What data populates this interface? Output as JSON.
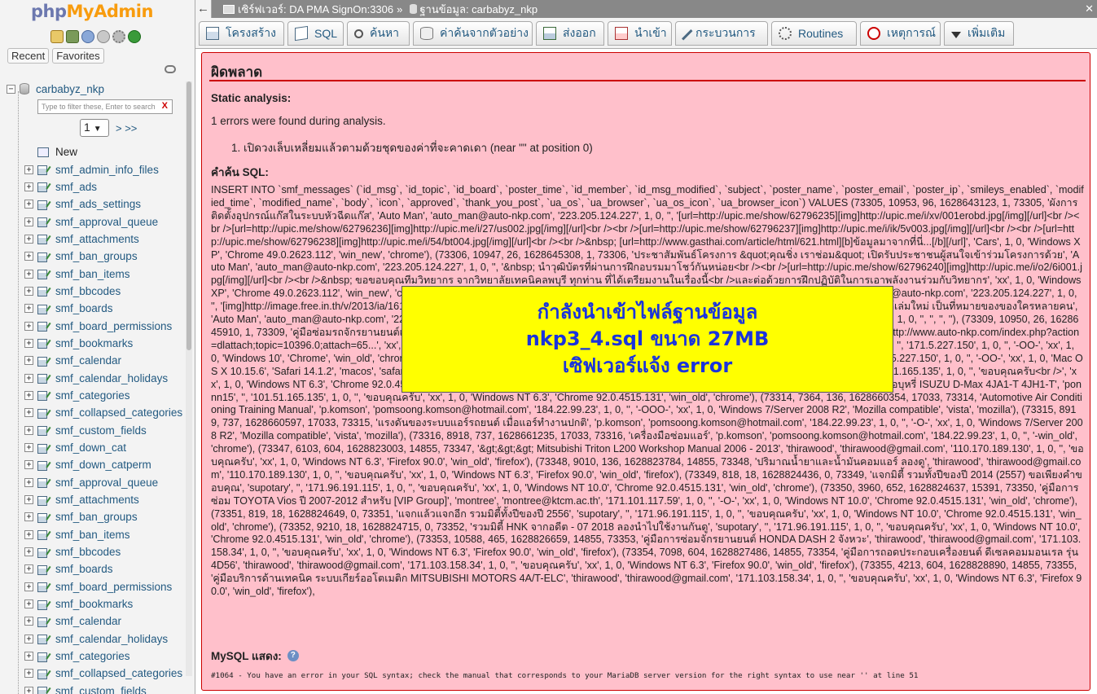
{
  "sidebar": {
    "logo_php": "php",
    "logo_pma": "MyAdmin",
    "quick_icons": [
      "home-icon",
      "logout-icon",
      "help-icon",
      "docs-icon",
      "settings-icon",
      "reload-icon"
    ],
    "tab_recent": "Recent",
    "tab_favorites": "Favorites",
    "database": "carbabyz_nkp",
    "filter_placeholder": "Type to filter these, Enter to search",
    "filter_clear": "X",
    "page_select": "1",
    "page_next": "> >>",
    "new_label": "New",
    "tables": [
      "smf_admin_info_files",
      "smf_ads",
      "smf_ads_settings",
      "smf_approval_queue",
      "smf_attachments",
      "smf_ban_groups",
      "smf_ban_items",
      "smf_bbcodes",
      "smf_boards",
      "smf_board_permissions",
      "smf_bookmarks",
      "smf_calendar",
      "smf_calendar_holidays",
      "smf_categories",
      "smf_collapsed_categories",
      "smf_custom_fields",
      "smf_down_cat",
      "smf_down_catperm",
      "smf_approval_queue",
      "smf_attachments",
      "smf_ban_groups",
      "smf_ban_items",
      "smf_bbcodes",
      "smf_boards",
      "smf_board_permissions",
      "smf_bookmarks",
      "smf_calendar",
      "smf_calendar_holidays",
      "smf_categories",
      "smf_collapsed_categories",
      "smf_custom_fields"
    ]
  },
  "breadcrumb": {
    "server": "เซิร์ฟเวอร์: DA PMA SignOn:3306",
    "separator": "»",
    "database": "ฐานข้อมูล: carbabyz_nkp"
  },
  "tabs": [
    {
      "label": "โครงสร้าง",
      "icon": "structure-icon"
    },
    {
      "label": "SQL",
      "icon": "sql-icon"
    },
    {
      "label": "ค้นหา",
      "icon": "search-icon"
    },
    {
      "label": "ค่าค้นจากตัวอย่าง",
      "icon": "query-icon"
    },
    {
      "label": "ส่งออก",
      "icon": "export-icon"
    },
    {
      "label": "นำเข้า",
      "icon": "import-icon"
    },
    {
      "label": "กระบวนการ",
      "icon": "operations-icon"
    },
    {
      "label": "Routines",
      "icon": "routines-icon"
    },
    {
      "label": "เหตุการณ์",
      "icon": "events-icon"
    },
    {
      "label": "เพิ่มเติม",
      "icon": "more-icon"
    }
  ],
  "error": {
    "title": "ผิดพลาด",
    "static_heading": "Static analysis:",
    "found_text": "1 errors were found during analysis.",
    "error_item": "1. เปิดวงเล็บเหลี่ยมแล้วตามด้วยชุดของค่าที่จะคาดเดา (near \"\" at position 0)",
    "query_heading": "คำค้น SQL:",
    "sql": "INSERT INTO `smf_messages` (`id_msg`, `id_topic`, `id_board`, `poster_time`, `id_member`, `id_msg_modified`, `subject`, `poster_name`, `poster_email`, `poster_ip`, `smileys_enabled`, `modified_time`, `modified_name`, `body`, `icon`, `approved`, `thank_you_post`, `ua_os`, `ua_browser`, `ua_os_icon`, `ua_browser_icon`) VALUES (73305, 10953, 96, 1628643123, 1, 73305, 'ผังการติดตั้งอุปกรณ์แก๊สในระบบหัวฉีดแก๊ส', 'Auto Man', 'auto_man@auto-nkp.com', '223.205.124.227', 1, 0, '', '[url=http://upic.me/show/62796235][img]http://upic.me/i/xv/001erobd.jpg[/img][/url]<br /><br />[url=http://upic.me/show/62796236][img]http://upic.me/i/27/us002.jpg[/img][/url]<br /><br />[url=http://upic.me/show/62796237][img]http://upic.me/i/ik/5v003.jpg[/img][/url]<br /><br />[url=http://upic.me/show/62796238][img]http://upic.me/i/54/bt004.jpg[/img][/url]<br /><br />&nbsp; [url=http://www.gasthai.com/article/html/621.html][b]ข้อมูลมาจากที่นี่...[/b][/url]', 'Cars', 1, 0, 'Windows XP', 'Chrome 49.0.2623.112', 'win_new', 'chrome'), (73306, 10947, 26, 1628645308, 1, 73306, 'ประชาสัมพันธ์โครงการ &quot;คุณชิ่ง เราช่อม&quot; เปิดรับประชาชนผู้สนใจเข้าร่วมโครงการด้วย', 'Auto Man', 'auto_man@auto-nkp.com', '223.205.124.227', 1, 0, '', '&nbsp; นำวุฒิบัตรที่ผ่านการฝึกอบรมมาโชว์กันหน่อย<br /><br />[url=http://upic.me/show/62796240][img]http://upic.me/i/o2/6i001.jpg[/img][/url]<br /><br />&nbsp; ขอขอบคุณทีมวิทยากร จากวิทยาลัยเทคนิคลพบุรี ทุกท่าน ที่ได้เตรียมงานในเรื่องนี้<br />และต่อด้วยการฝึกปฏิบัติในการเอาพลังงานร่วมกับวิทยากร', 'xx', 1, 0, 'Windows XP', 'Chrome 49.0.2623.112', 'win_new', 'chrome'), (73307, 10950, 26, 1628645592, 1, 73307, 'คู่มือซ่อมรถจักรยานยนต์เล่มใหม่', 'Auto Man', 'auto_man@auto-nkp.com', '223.205.124.227', 1, 0, '', '[img]http://image.free.in.th/v/2013/ia/161103014421.jpg[/img]', 'xx', 1, 0, '', '', '', ''), (73308, 10950, 26, 1628645872, 1, 73308, 'คู่มือซ่อมรถจักรยานยนต์เล่มใหม่ เป็นที่หมายของของใครหลายคน', 'Auto Man', 'auto_man@auto-nkp.com', '223.205.124.227', 1, 0, '', 'http://www.auto-nkp.com/index.php?action=dlattach;topic=10390.0;attach=65...', 'xx', 1, 0, '', '', '', ''), (73309, 10950, 26, 1628645910, 1, 73309, 'คู่มือซ่อมรถจักรยานยนต์เล่มใหม่ เป็นที่หมายของของใครหลายคน', 'Auto Man', 'auto_man@auto-nkp.com', '223.205.124.227', 1, 0, '', 'http://www.auto-nkp.com/index.php?action=dlattach;topic=10396.0;attach=65...', 'xx', 1, 0, '', '', '', ''), (73310, 10950, 26, 1628648160, 0, 73310, '&gt;&gt;&gt;คู่มือซ่อม NissanCube2009', 'Browser', '', '171.5.227.150', 1, 0, '', '-OO-', 'xx', 1, 0, 'Windows 10', 'Chrome', 'win_old', 'chrome'), (73311, 7297, 587, 1628648170, 0, 73311, 'Datsun 620 Series 1977 Service Manual', 'Browser', '', '171.5.227.150', 1, 0, '', '-OO-', 'xx', 1, 0, 'Mac OS X 10.15.6', 'Safari 14.1.2', 'macos', 'safari'), (73312, 7517, 24, 1628652924, 0, 73312, 'Wiring Diagram ABS HONDA FORZA 300', 'ponnn15', '', '101.51.165.135', 1, 0, '', 'ขอบคุณครับ<br />', 'xx', 1, 0, 'Windows NT 6.3', 'Chrome 92.0.4515.131', 'win_old', 'chrome'), (73313, 8049, 10, 1628656454, 0, 73313, 'ผังการเดินสายไฟ วิทยุ นาฬิกาแลร์ที่จอบุหรี่ ISUZU D-Max 4JA1-T 4JH1-T', 'ponnn15', '', '101.51.165.135', 1, 0, '', 'ขอบคุณครับ', 'xx', 1, 0, 'Windows NT 6.3', 'Chrome 92.0.4515.131', 'win_old', 'chrome'), (73314, 7364, 136, 1628660354, 17033, 73314, 'Automotive Air Conditioning Training Manual', 'p.komson', 'pomsoong.komson@hotmail.com', '184.22.99.23', 1, 0, '', '-OOO-', 'xx', 1, 0, 'Windows 7/Server 2008 R2', 'Mozilla compatible', 'vista', 'mozilla'), (73315, 8919, 737, 1628660597, 17033, 73315, 'แรงดันของระบบแอร์รถยนต์ เมื่อแอร์ทำงานปกติ', 'p.komson', 'pomsoong.komson@hotmail.com', '184.22.99.23', 1, 0, '', '-O-', 'xx', 1, 0, 'Windows 7/Server 2008 R2', 'Mozilla compatible', 'vista', 'mozilla'), (73316, 8918, 737, 1628661235, 17033, 73316, 'เครื่องมือซ่อมแอร์', 'p.komson', 'pomsoong.komson@hotmail.com', '184.22.99.23', 1, 0, '', '-win_old', 'chrome'), (73347, 6103, 604, 1628823003, 14855, 73347, '&gt;&gt;&gt; Mitsubishi Triton L200 Workshop Manual 2006 - 2013', 'thirawood', 'thirawood@gmail.com', '110.170.189.130', 1, 0, '', 'ขอบคุณครับ', 'xx', 1, 0, 'Windows NT 6.3', 'Firefox 90.0', 'win_old', 'firefox'), (73348, 9010, 136, 1628823784, 14855, 73348, 'ปริมาณน้ำยาและน้ำมันคอมแอร์ ลองดู', 'thirawood', 'thirawood@gmail.com', '110.170.189.130', 1, 0, '', 'ขอบคุณครับ', 'xx', 1, 0, 'Windows NT 6.3', 'Firefox 90.0', 'win_old', 'firefox'), (73349, 818, 18, 1628824436, 0, 73349, 'แจกมิตี้ รวมทั้งปีของปี 2014 (2557) ขอเพียงคำขอบคุณ', 'supotary', '', '171.96.191.115', 1, 0, '', 'ขอบคุณครับ', 'xx', 1, 0, 'Windows NT 10.0', 'Chrome 92.0.4515.131', 'win_old', 'chrome'), (73350, 3960, 652, 1628824637, 15391, 73350, 'คู่มือการซ่อม TOYOTA Vios ปี 2007-2012 สำหรับ [VIP Group]', 'montree', 'montree@ktcm.ac.th', '171.101.117.59', 1, 0, '', '-O-', 'xx', 1, 0, 'Windows NT 10.0', 'Chrome 92.0.4515.131', 'win_old', 'chrome'), (73351, 819, 18, 1628824649, 0, 73351, 'แจกแล้วแจกอีก รวมมิตี้ทั้งปีของปี 2556', 'supotary', '', '171.96.191.115', 1, 0, '', 'ขอบคุณครับ', 'xx', 1, 0, 'Windows NT 10.0', 'Chrome 92.0.4515.131', 'win_old', 'chrome'), (73352, 9210, 18, 1628824715, 0, 73352, 'รวมมิตี้ HNK จากอดีต - 07 2018 ลองนำไปใช้งานกันดู', 'supotary', '', '171.96.191.115', 1, 0, '', 'ขอบคุณครับ', 'xx', 1, 0, 'Windows NT 10.0', 'Chrome 92.0.4515.131', 'win_old', 'chrome'), (73353, 10588, 465, 1628826659, 14855, 73353, 'คู่มือการซ่อมจักรยานยนต์ HONDA DASH 2 จังหวะ', 'thirawood', 'thirawood@gmail.com', '171.103.158.34', 1, 0, '', 'ขอบคุณครับ', 'xx', 1, 0, 'Windows NT 6.3', 'Firefox 90.0', 'win_old', 'firefox'), (73354, 7098, 604, 1628827486, 14855, 73354, 'คู่มือการถอดประกอบเครื่องยนต์ ดีเซลคอมมอนเรล รุ่น 4D56', 'thirawood', 'thirawood@gmail.com', '171.103.158.34', 1, 0, '', 'ขอบคุณครับ', 'xx', 1, 0, 'Windows NT 6.3', 'Firefox 90.0', 'win_old', 'firefox'), (73355, 4213, 604, 1628828890, 14855, 73355, 'คู่มือบริการด้านเทคนิค ระบบเกียร์ออโตเมติก MITSUBISHI MOTORS 4A/T-ELC', 'thirawood', 'thirawood@gmail.com', '171.103.158.34', 1, 0, '', 'ขอบคุณครับ', 'xx', 1, 0, 'Windows NT 6.3', 'Firefox 90.0', 'win_old', 'firefox'),",
    "mysql_heading": "MySQL แสดง:",
    "mysql_message": "#1064 - You have an error in your SQL syntax; check the manual that corresponds to your MariaDB server version for the right syntax to use near '' at line 51"
  },
  "overlay": {
    "line1": "กำลังนำเข้าไฟล์ฐานข้อมูล",
    "line2": "nkp3_4.sql ขนาด 27MB",
    "line3": "เซิฟเวอร์แจ้ง error"
  },
  "colors": {
    "error_bg": "#ffc0cb",
    "error_border": "#cc0000",
    "overlay_bg": "#ffff00",
    "overlay_text": "#1a33dd",
    "link": "#235a81"
  }
}
